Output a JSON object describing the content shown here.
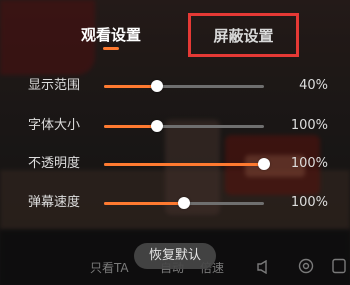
{
  "tabs": {
    "watch_label": "观看设置",
    "block_label": "屏蔽设置",
    "active": "观看设置"
  },
  "settings": [
    {
      "label": "显示范围",
      "value": "40%",
      "fraction": 0.33
    },
    {
      "label": "字体大小",
      "value": "100%",
      "fraction": 0.33
    },
    {
      "label": "不透明度",
      "value": "100%",
      "fraction": 1.0
    },
    {
      "label": "弹幕速度",
      "value": "100%",
      "fraction": 0.5
    }
  ],
  "reset_label": "恢复默认",
  "bottom_bar": {
    "item1": "只看TA",
    "item2": "自动",
    "item3": "倍速"
  },
  "colors": {
    "accent": "#ff7a30",
    "highlight_box": "#e53935",
    "track": "#6f6f6f",
    "thumb": "#ffffff"
  }
}
